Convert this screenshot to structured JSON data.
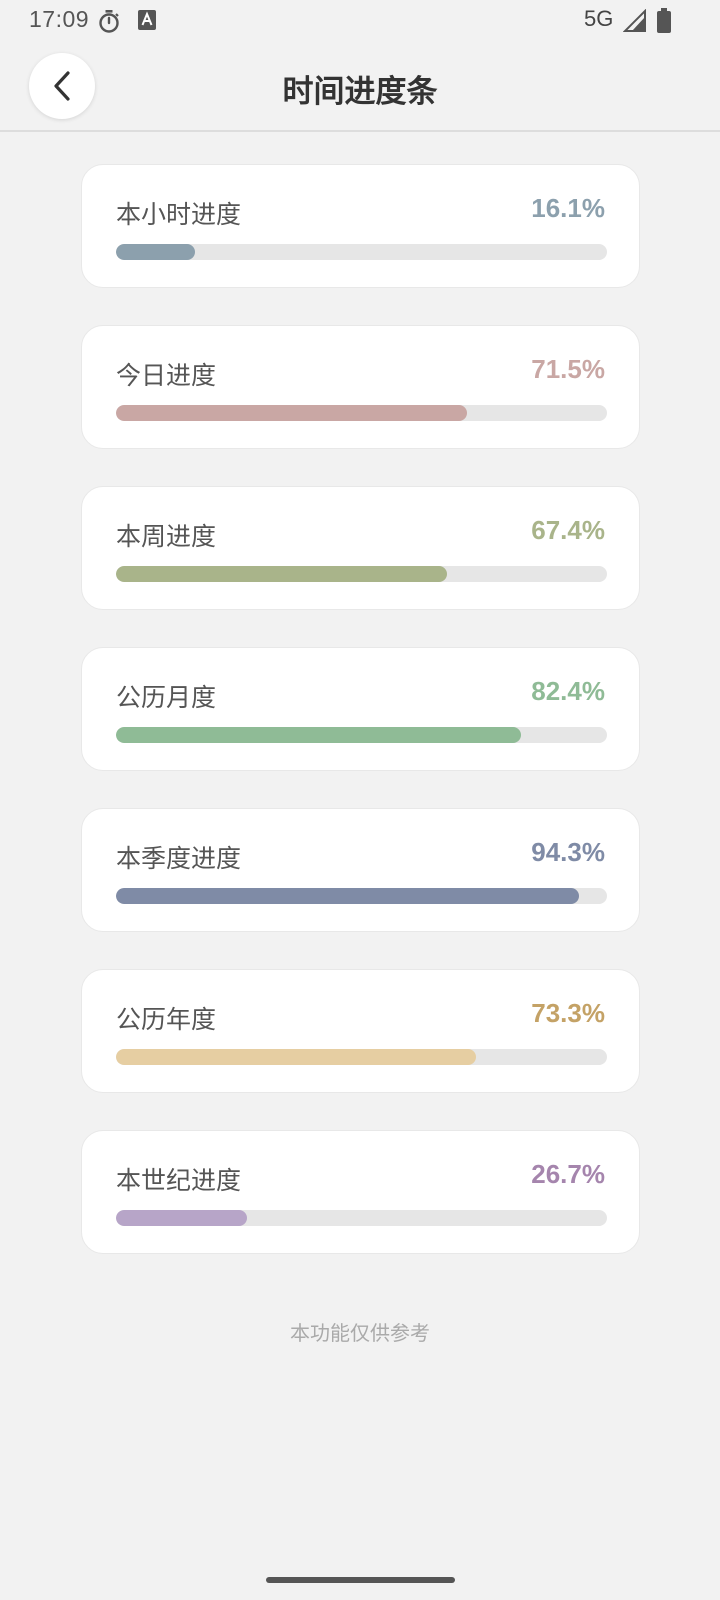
{
  "status_bar": {
    "time": "17:09",
    "network": "5G",
    "icons": [
      "stopwatch-icon",
      "a-icon",
      "signal-icon",
      "battery-icon"
    ]
  },
  "header": {
    "title": "时间进度条",
    "back_icon": "chevron-left-icon"
  },
  "progress_items": [
    {
      "label": "本小时进度",
      "percent_text": "16.1%",
      "value": 16.1,
      "color": "#8ca0ad"
    },
    {
      "label": "今日进度",
      "percent_text": "71.5%",
      "value": 71.5,
      "color": "#c9a7a4"
    },
    {
      "label": "本周进度",
      "percent_text": "67.4%",
      "value": 67.4,
      "color": "#a9b48a"
    },
    {
      "label": "公历月度",
      "percent_text": "82.4%",
      "value": 82.4,
      "color": "#8fbb96"
    },
    {
      "label": "本季度进度",
      "percent_text": "94.3%",
      "value": 94.3,
      "color": "#7f8ba6"
    },
    {
      "label": "公历年度",
      "percent_text": "73.3%",
      "value": 73.3,
      "color": "#e6cea2",
      "text_color": "#c4a266"
    },
    {
      "label": "本世纪进度",
      "percent_text": "26.7%",
      "value": 26.7,
      "color": "#b7a5c8",
      "text_color": "#a585ad"
    }
  ],
  "footer": {
    "note": "本功能仅供参考"
  }
}
